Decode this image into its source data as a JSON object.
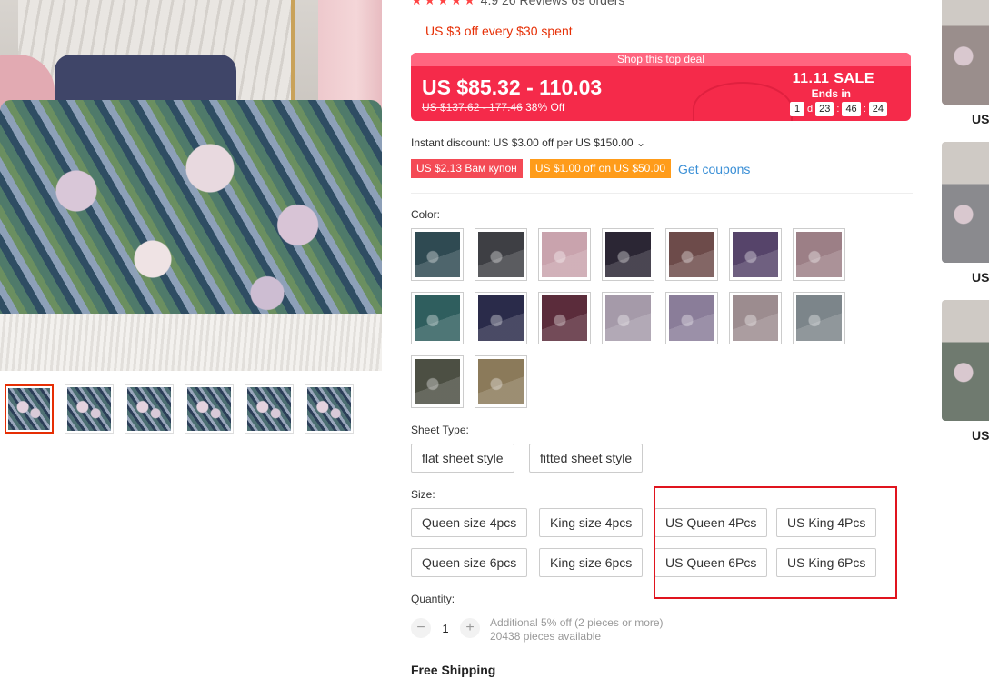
{
  "rating": {
    "stars": "★★★★★",
    "text": "4.9   26 Reviews  69 orders"
  },
  "promo": {
    "text": "US $3 off every $30 spent"
  },
  "deal": {
    "header": "Shop this top deal",
    "price": "US $85.32 - 110.03",
    "original_price": "US $137.62 - 177.46",
    "discount": "38% Off",
    "sale_title": "11.11 SALE",
    "ends_in": "Ends in",
    "timer": {
      "days": "1",
      "day_unit": "d",
      "hours": "23",
      "minutes": "46",
      "seconds": "24"
    }
  },
  "instant_discount": "Instant discount: US $3.00 off per US $150.00 ⌄",
  "coupons": [
    {
      "text": "US $2.13 Вам купон",
      "color": "#f44a55"
    },
    {
      "text": "US $1.00 off on US $50.00",
      "color": "#ff9c1a"
    }
  ],
  "get_coupons": "Get coupons",
  "color": {
    "label": "Color:",
    "swatches": [
      {
        "name": "dark teal",
        "bg": "#2f4a52"
      },
      {
        "name": "grey room",
        "bg": "#3e3f44"
      },
      {
        "name": "pink floral",
        "bg": "#c9a3ad"
      },
      {
        "name": "dark floral",
        "bg": "#2b2634"
      },
      {
        "name": "brown floral",
        "bg": "#6d4b4a"
      },
      {
        "name": "purple floral",
        "bg": "#56446a"
      },
      {
        "name": "rose",
        "bg": "#9c7f86"
      },
      {
        "name": "green leaf",
        "bg": "#2f5e5e"
      },
      {
        "name": "night blue",
        "bg": "#2a2b4a"
      },
      {
        "name": "burgundy",
        "bg": "#5b2c3b"
      },
      {
        "name": "lavender",
        "bg": "#a59aa9"
      },
      {
        "name": "lilac",
        "bg": "#8a7d99"
      },
      {
        "name": "mauve",
        "bg": "#9c8c8f"
      },
      {
        "name": "grey leaf",
        "bg": "#7c858a"
      },
      {
        "name": "olive",
        "bg": "#4c4f43"
      },
      {
        "name": "gold",
        "bg": "#8b7a5a"
      }
    ]
  },
  "sheet_type": {
    "label": "Sheet Type:",
    "options": [
      "flat sheet style",
      "fitted sheet style"
    ]
  },
  "size": {
    "label": "Size:",
    "options": [
      "Queen size 4pcs",
      "King size 4pcs",
      "US Queen 4Pcs",
      "US King 4Pcs",
      "Queen size 6pcs",
      "King size 6pcs",
      "US Queen 6Pcs",
      "US King 6Pcs"
    ]
  },
  "quantity": {
    "label": "Quantity:",
    "minus": "−",
    "value": "1",
    "plus": "+",
    "note_1": "Additional 5% off (2 pieces or more)",
    "note_2": "20438 pieces available"
  },
  "free_shipping": "Free Shipping",
  "side_items": [
    {
      "price": "US",
      "bg": "#9a8e8c"
    },
    {
      "price": "US",
      "bg": "#8a8a8e"
    },
    {
      "price": "US",
      "bg": "#6f7a6f"
    }
  ]
}
